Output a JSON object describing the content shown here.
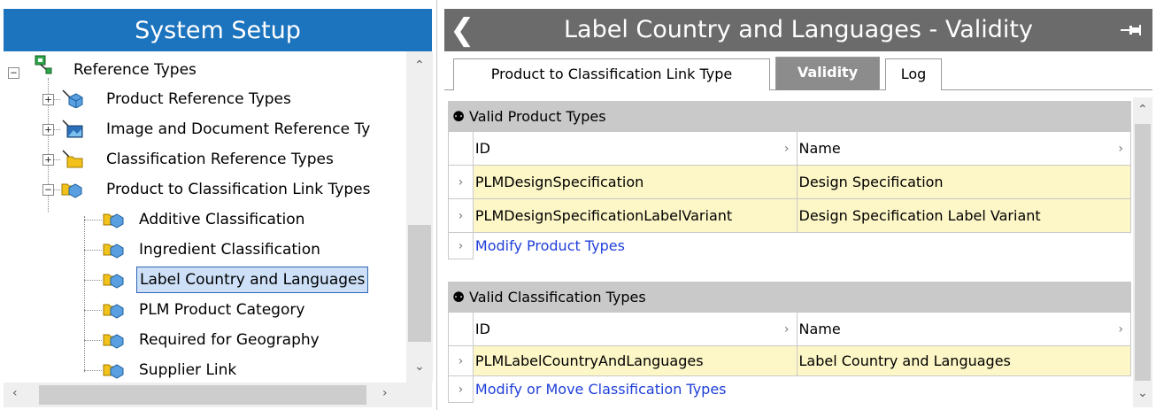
{
  "left_panel": {
    "title": "System Setup",
    "tree": [
      {
        "label": "Reference Types",
        "icon": "reference-types-icon",
        "expander": "minus"
      },
      {
        "label": "Product Reference Types",
        "icon": "product-reference-icon",
        "expander": "plus"
      },
      {
        "label": "Image and Document Reference Ty",
        "icon": "image-reference-icon",
        "expander": "plus"
      },
      {
        "label": "Classification Reference Types",
        "icon": "classification-reference-icon",
        "expander": "plus"
      },
      {
        "label": "Product to Classification Link Types",
        "icon": "link-type-icon",
        "expander": "minus"
      },
      {
        "label": "Additive Classification",
        "icon": "link-type-icon"
      },
      {
        "label": "Ingredient Classification",
        "icon": "link-type-icon"
      },
      {
        "label": "Label Country and Languages",
        "icon": "link-type-icon",
        "selected": true
      },
      {
        "label": "PLM Product Category",
        "icon": "link-type-icon"
      },
      {
        "label": "Required for Geography",
        "icon": "link-type-icon"
      },
      {
        "label": "Supplier Link",
        "icon": "link-type-icon"
      }
    ]
  },
  "right_panel": {
    "title": "Label Country and Languages - Validity",
    "tabs": [
      {
        "label": "Product to Classification Link Type",
        "active": false
      },
      {
        "label": "Validity",
        "active": true
      },
      {
        "label": "Log",
        "active": false
      }
    ],
    "sections": [
      {
        "title": "Valid Product Types",
        "columns": [
          "ID",
          "Name"
        ],
        "rows": [
          {
            "id": "PLMDesignSpecification",
            "name": "Design Specification"
          },
          {
            "id": "PLMDesignSpecificationLabelVariant",
            "name": "Design Specification Label Variant"
          }
        ],
        "action": "Modify Product Types"
      },
      {
        "title": "Valid Classification Types",
        "columns": [
          "ID",
          "Name"
        ],
        "rows": [
          {
            "id": "PLMLabelCountryAndLanguages",
            "name": "Label Country and Languages"
          }
        ],
        "action": "Modify or Move Classification Types"
      }
    ]
  },
  "colors": {
    "left_header_bg": "#1c73be",
    "right_header_bg": "#6b6b6b",
    "row_highlight": "#fdf6c6",
    "link": "#1f3fd9",
    "selection": "#cde0f7"
  }
}
